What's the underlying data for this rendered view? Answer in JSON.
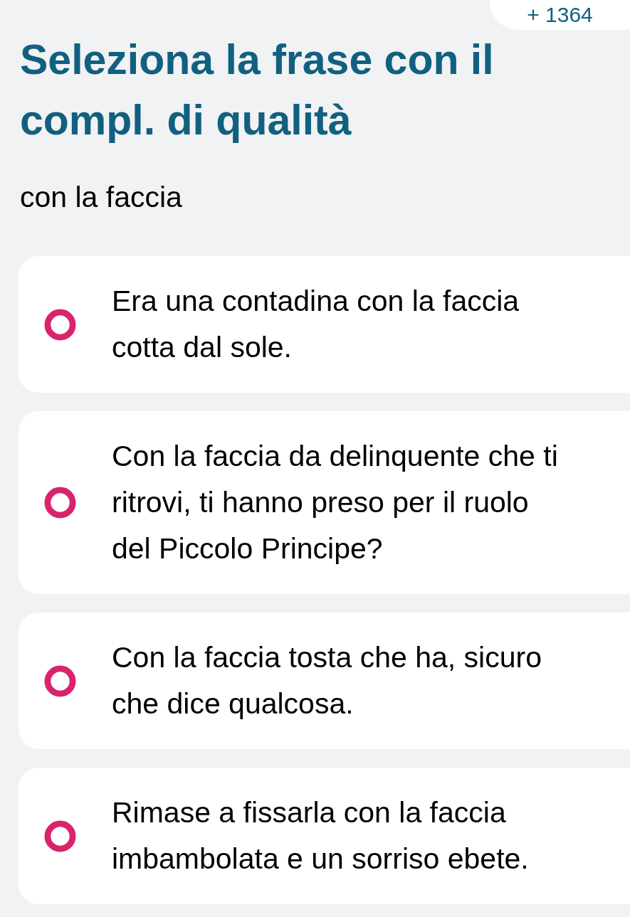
{
  "score_badge": "+ 1364",
  "question": {
    "title": "Seleziona la frase con il compl. di qualità",
    "prompt": "con la faccia"
  },
  "options": [
    {
      "text": "Era una contadina con la faccia cotta dal sole.",
      "selected": false
    },
    {
      "text": "Con la faccia da delinquente che ti ritrovi, ti hanno preso per il ruolo del Piccolo Principe?",
      "selected": false
    },
    {
      "text": "Con la faccia tosta che ha, sicuro che dice qualcosa.",
      "selected": false
    },
    {
      "text": "Rimase a fissarla con la faccia imbambolata e un sorriso ebete.",
      "selected": false
    }
  ]
}
